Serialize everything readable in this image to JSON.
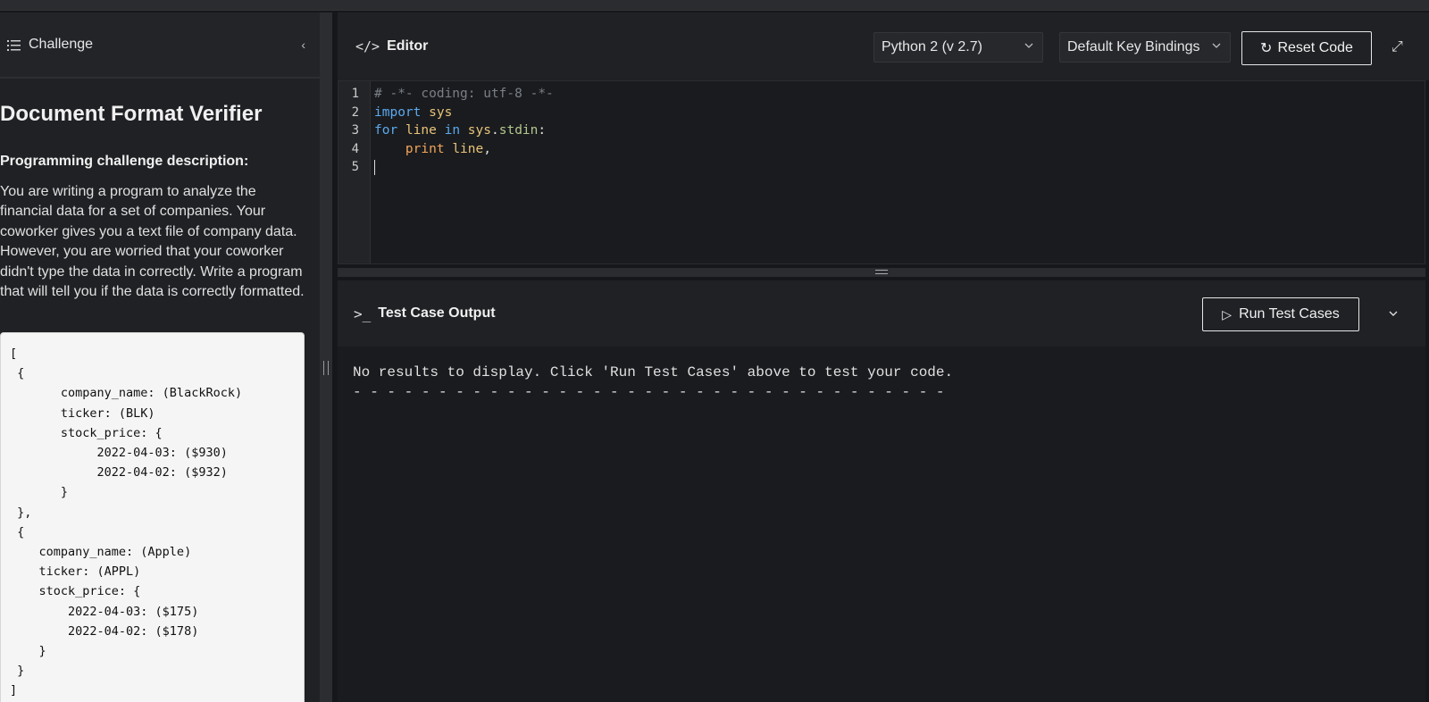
{
  "sidebar": {
    "header_label": "Challenge",
    "collapse_glyph": "‹",
    "title": "Document Format Verifier",
    "description_heading": "Programming challenge description:",
    "description": "You are writing a program to analyze the financial data for a set of companies. Your coworker gives you a text file of company data. However, you are worried that your coworker didn't type the data in correctly. Write a program that will tell you if the data is correctly formatted.",
    "example": "[\n {\n       company_name: (BlackRock)\n       ticker: (BLK)\n       stock_price: {\n            2022-04-03: ($930)\n            2022-04-02: ($932)\n       }\n },\n {\n    company_name: (Apple)\n    ticker: (APPL)\n    stock_price: {\n        2022-04-03: ($175)\n        2022-04-02: ($178)\n    }\n }\n]"
  },
  "editor": {
    "icon_glyph": "</>",
    "title": "Editor",
    "language": "Python 2 (v 2.7)",
    "key_bindings": "Default Key Bindings",
    "reset_label": "Reset Code",
    "reset_glyph": "↻",
    "expand_glyph": "⤢",
    "line_numbers": [
      "1",
      "2",
      "3",
      "4",
      "5"
    ],
    "code": {
      "line1": "# -*- coding: utf-8 -*-",
      "l2_kw": "import",
      "l2_mod": "sys",
      "l3_for": "for",
      "l3_var": "line",
      "l3_in": "in",
      "l3_obj": "sys",
      "l3_attr": "stdin",
      "l4_print": "print",
      "l4_var": "line"
    }
  },
  "output": {
    "icon_glyph": ">_",
    "title": "Test Case Output",
    "run_label": "Run Test Cases",
    "run_glyph": "▷",
    "menu_glyph": "⌄",
    "message": "No results to display. Click 'Run Test Cases' above to test your code.",
    "separator": "- - - - - - - - - - - - - - - - - - - - - - - - - - - - - - - - - - -"
  },
  "icons": {
    "sidebar": "list-icon",
    "collapse": "chevron-left-icon",
    "editor": "code-icon",
    "select": "chevron-down-icon",
    "reset": "refresh-icon",
    "expand": "expand-icon",
    "terminal": "terminal-icon",
    "run": "play-icon"
  },
  "colors": {
    "background": "#16171a",
    "panel": "#1f2124",
    "keyword": "#5aa9f0",
    "variable": "#e8c47a",
    "comment": "#7a7f87"
  }
}
